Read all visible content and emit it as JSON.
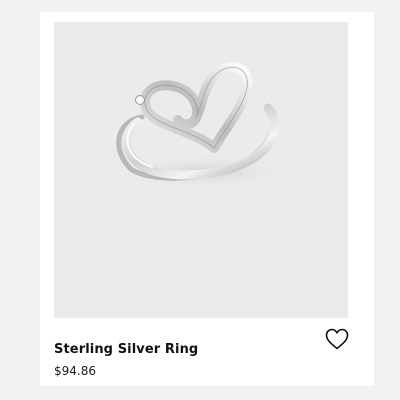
{
  "product": {
    "name": "Sterling Silver Ring",
    "price": "$94.86",
    "image_subject": "sterling silver open heart ring with small stone"
  },
  "wishlist": {
    "icon": "heart-outline-icon"
  },
  "colors": {
    "page_background": "#f2f2f2",
    "card_background": "#ffffff",
    "image_background": "#ebebeb",
    "text": "#111111"
  }
}
